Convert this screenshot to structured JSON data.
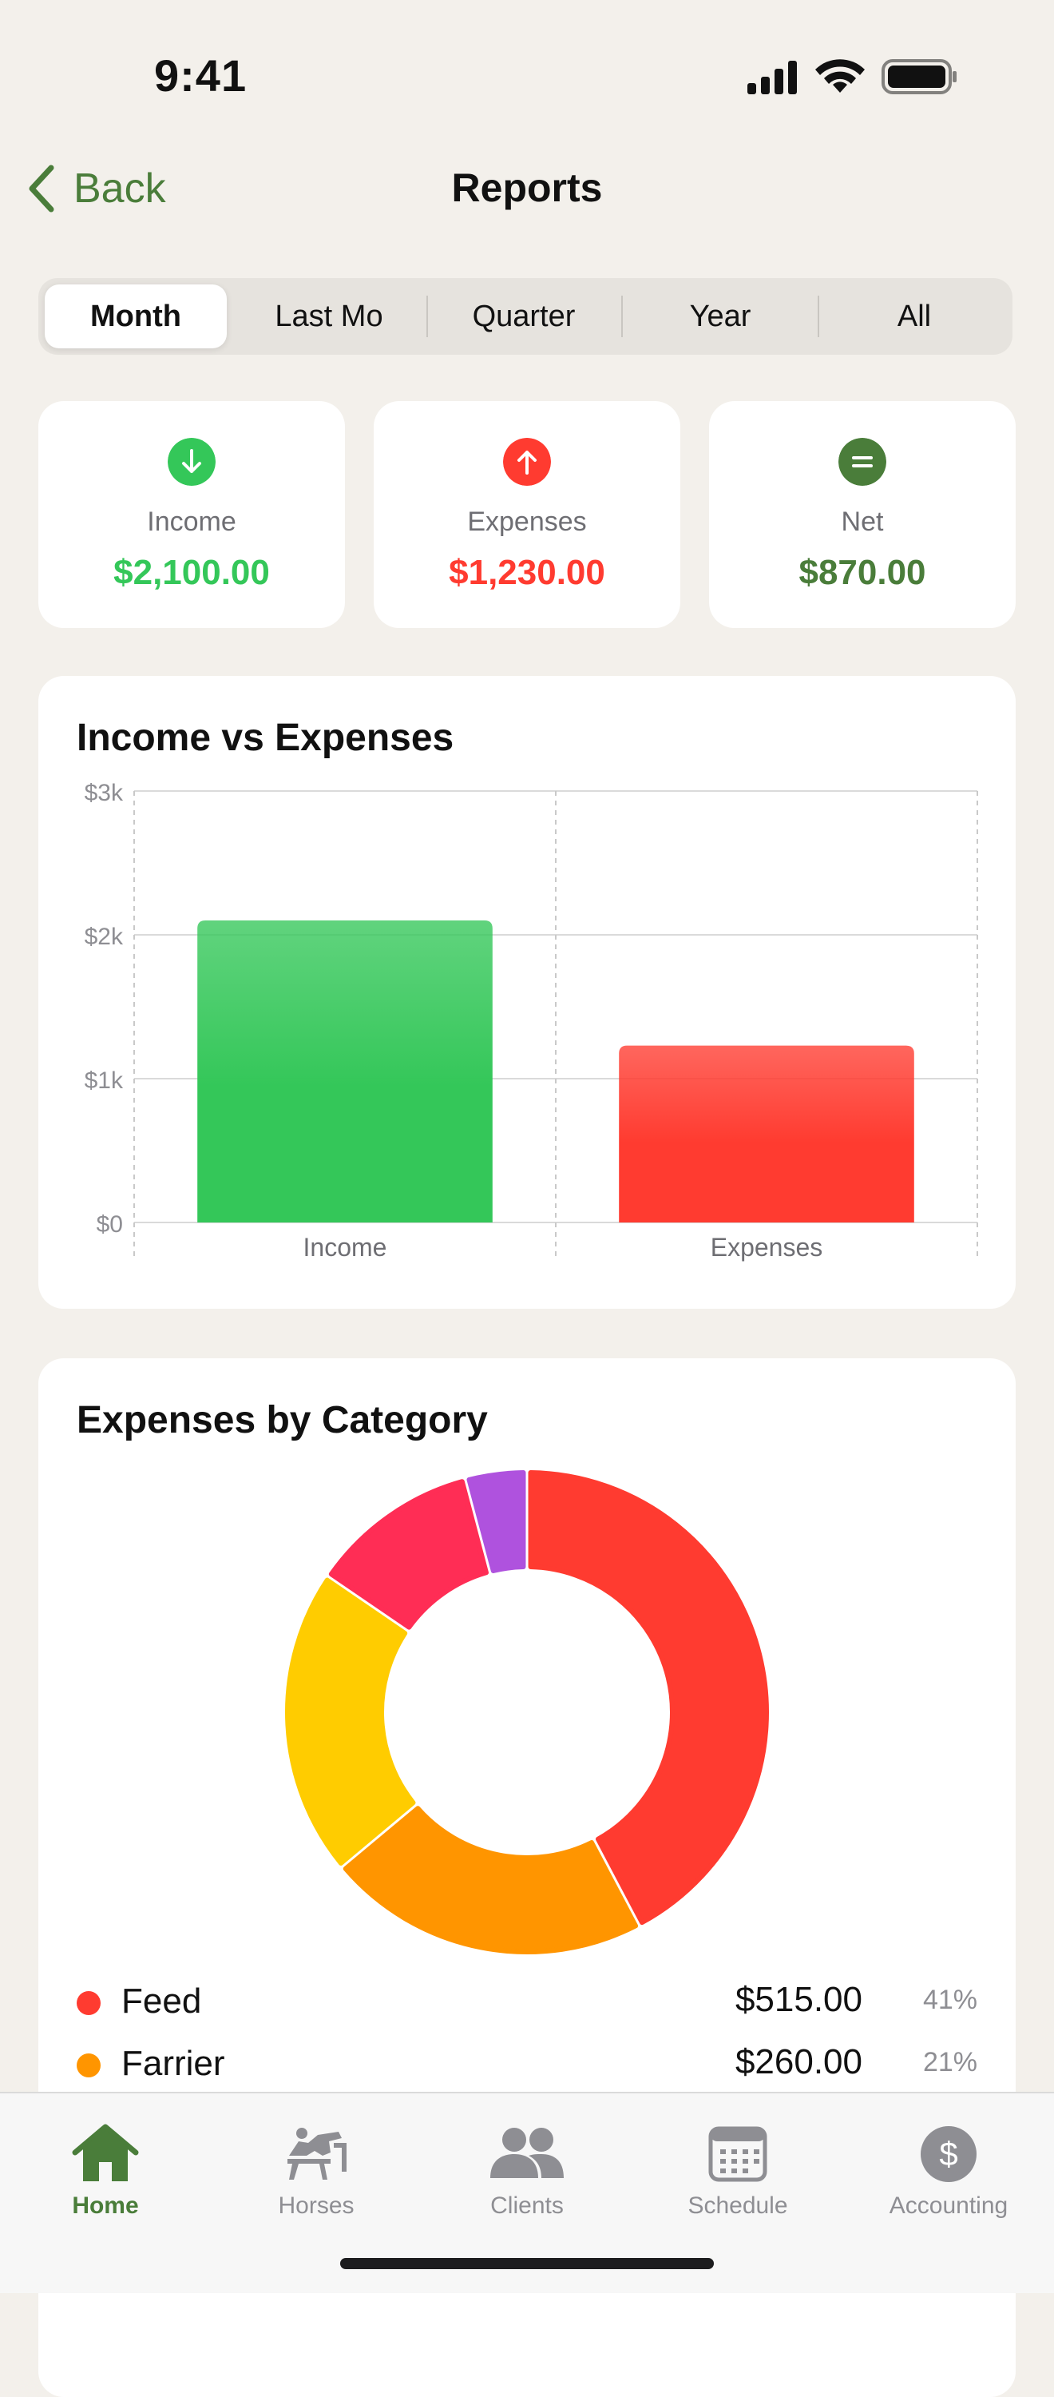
{
  "status_bar": {
    "time": "9:41"
  },
  "nav": {
    "back_label": "Back",
    "title": "Reports"
  },
  "segments": [
    {
      "label": "Month",
      "active": true
    },
    {
      "label": "Last Mo",
      "active": false
    },
    {
      "label": "Quarter",
      "active": false
    },
    {
      "label": "Year",
      "active": false
    },
    {
      "label": "All",
      "active": false
    }
  ],
  "summary": {
    "income": {
      "label": "Income",
      "value": "$2,100.00",
      "color": "#34C759",
      "icon": "arrow-down-icon"
    },
    "expenses": {
      "label": "Expenses",
      "value": "$1,230.00",
      "color": "#FF3B30",
      "icon": "arrow-up-icon"
    },
    "net": {
      "label": "Net",
      "value": "$870.00",
      "color": "#4A7D3A",
      "icon": "equals-icon"
    }
  },
  "bar_chart": {
    "title": "Income vs Expenses"
  },
  "donut_chart": {
    "title": "Expenses by Category"
  },
  "legend": [
    {
      "name": "Feed",
      "amount": "$515.00",
      "percent": "41%",
      "color": "#FF3B30"
    },
    {
      "name": "Farrier",
      "amount": "$260.00",
      "percent": "21%",
      "color": "#FF9500"
    }
  ],
  "tabbar": {
    "items": [
      {
        "label": "Home",
        "icon": "home-icon",
        "active": true
      },
      {
        "label": "Horses",
        "icon": "horse-icon",
        "active": false
      },
      {
        "label": "Clients",
        "icon": "clients-icon",
        "active": false
      },
      {
        "label": "Schedule",
        "icon": "calendar-icon",
        "active": false
      },
      {
        "label": "Accounting",
        "icon": "dollar-icon",
        "active": false
      }
    ]
  },
  "chart_data": [
    {
      "type": "bar",
      "title": "Income vs Expenses",
      "categories": [
        "Income",
        "Expenses"
      ],
      "values": [
        2100,
        1230
      ],
      "colors": [
        "#34C759",
        "#FF3B30"
      ],
      "yticks": [
        "$0",
        "$1k",
        "$2k",
        "$3k"
      ],
      "ylim": [
        0,
        3000
      ],
      "grid": true
    },
    {
      "type": "pie",
      "title": "Expenses by Category",
      "donut": true,
      "slices": [
        {
          "label": "Feed",
          "value": 41,
          "color": "#FF3B30"
        },
        {
          "label": "Farrier",
          "value": 21,
          "color": "#FF9500"
        },
        {
          "label": "",
          "value": 20,
          "color": "#FFCC00"
        },
        {
          "label": "",
          "value": 11,
          "color": "#FF2D55"
        },
        {
          "label": "",
          "value": 4,
          "color": "#AF52DE"
        }
      ]
    }
  ]
}
